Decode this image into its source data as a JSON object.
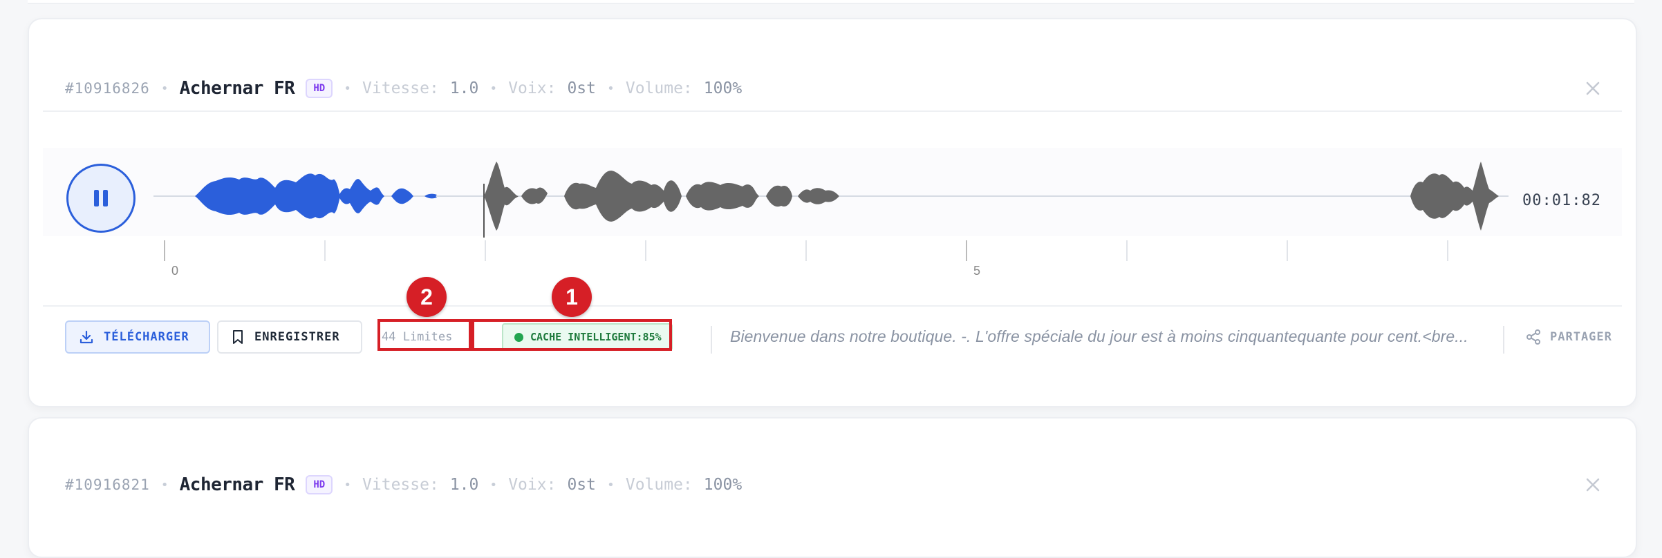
{
  "entries": [
    {
      "id": "#10916826",
      "voice": "Achernar FR",
      "quality_badge": "HD",
      "speed_label": "Vitesse:",
      "speed_value": "1.0",
      "pitch_label": "Voix:",
      "pitch_value": "0st",
      "volume_label": "Volume:",
      "volume_value": "100%"
    },
    {
      "id": "#10916821",
      "voice": "Achernar FR",
      "quality_badge": "HD",
      "speed_label": "Vitesse:",
      "speed_value": "1.0",
      "pitch_label": "Voix:",
      "pitch_value": "0st",
      "volume_label": "Volume:",
      "volume_value": "100%"
    }
  ],
  "player": {
    "time": "00:01:82",
    "ruler_labels": [
      "0",
      "5"
    ],
    "played_color": "#2563eb",
    "unplayed_color": "#666666"
  },
  "actions": {
    "download_label": "TÉLÉCHARGER",
    "save_label": "ENREGISTRER",
    "limits": "44 Limites",
    "cache": "CACHE INTELLIGENT:85%",
    "snippet": "Bienvenue dans notre boutique. -. L'offre spéciale du jour est à moins cinquantequante pour cent.<bre...",
    "share_label": "PARTAGER"
  },
  "annotations": [
    "1",
    "2"
  ],
  "icons": [
    "close-icon",
    "pause-icon",
    "download-icon",
    "bookmark-icon",
    "share-icon",
    "status-dot-icon"
  ]
}
